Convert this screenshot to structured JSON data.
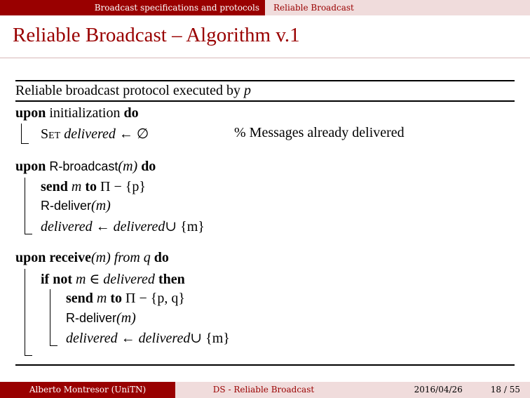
{
  "header": {
    "section": "Broadcast specifications and protocols",
    "subsection": "Reliable Broadcast"
  },
  "slide": {
    "title": "Reliable Broadcast – Algorithm v.1"
  },
  "algorithm": {
    "caption": "Reliable broadcast protocol executed by",
    "caption_var": "p",
    "init": {
      "upon": "upon",
      "event": "initialization",
      "do": "do",
      "set_kw": "Set",
      "set_var": "delivered",
      "set_rest": "← ∅",
      "comment": "%  Messages already delivered"
    },
    "rbcast": {
      "upon": "upon",
      "event": "R-broadcast",
      "arg": "(m)",
      "do": "do",
      "send_kw": "send",
      "send_var": "m",
      "to_kw": "to",
      "send_rest": "Π − {p}",
      "deliver": "R-deliver",
      "deliver_arg": "(m)",
      "update_lhs": "delivered",
      "update_arrow": "←",
      "update_rhs": "delivered",
      "update_rest": "∪ {m}"
    },
    "receive": {
      "upon": "upon",
      "event": "receive",
      "arg": "(m)",
      "from_kw": "from",
      "from_var": "q",
      "do": "do",
      "if_kw": "if",
      "not_kw": "not",
      "cond_var": "m ∈",
      "cond_set": "delivered",
      "then_kw": "then",
      "send_kw": "send",
      "send_var": "m",
      "to_kw": "to",
      "send_rest": "Π − {p, q}",
      "deliver": "R-deliver",
      "deliver_arg": "(m)",
      "update_lhs": "delivered",
      "update_arrow": "←",
      "update_rhs": "delivered",
      "update_rest": "∪ {m}"
    }
  },
  "footer": {
    "author": "Alberto Montresor  (UniTN)",
    "title": "DS - Reliable Broadcast",
    "date": "2016/04/26",
    "page": "18 / 55"
  },
  "colors": {
    "accent": "#990000",
    "accent_light": "#f0dcdc"
  }
}
